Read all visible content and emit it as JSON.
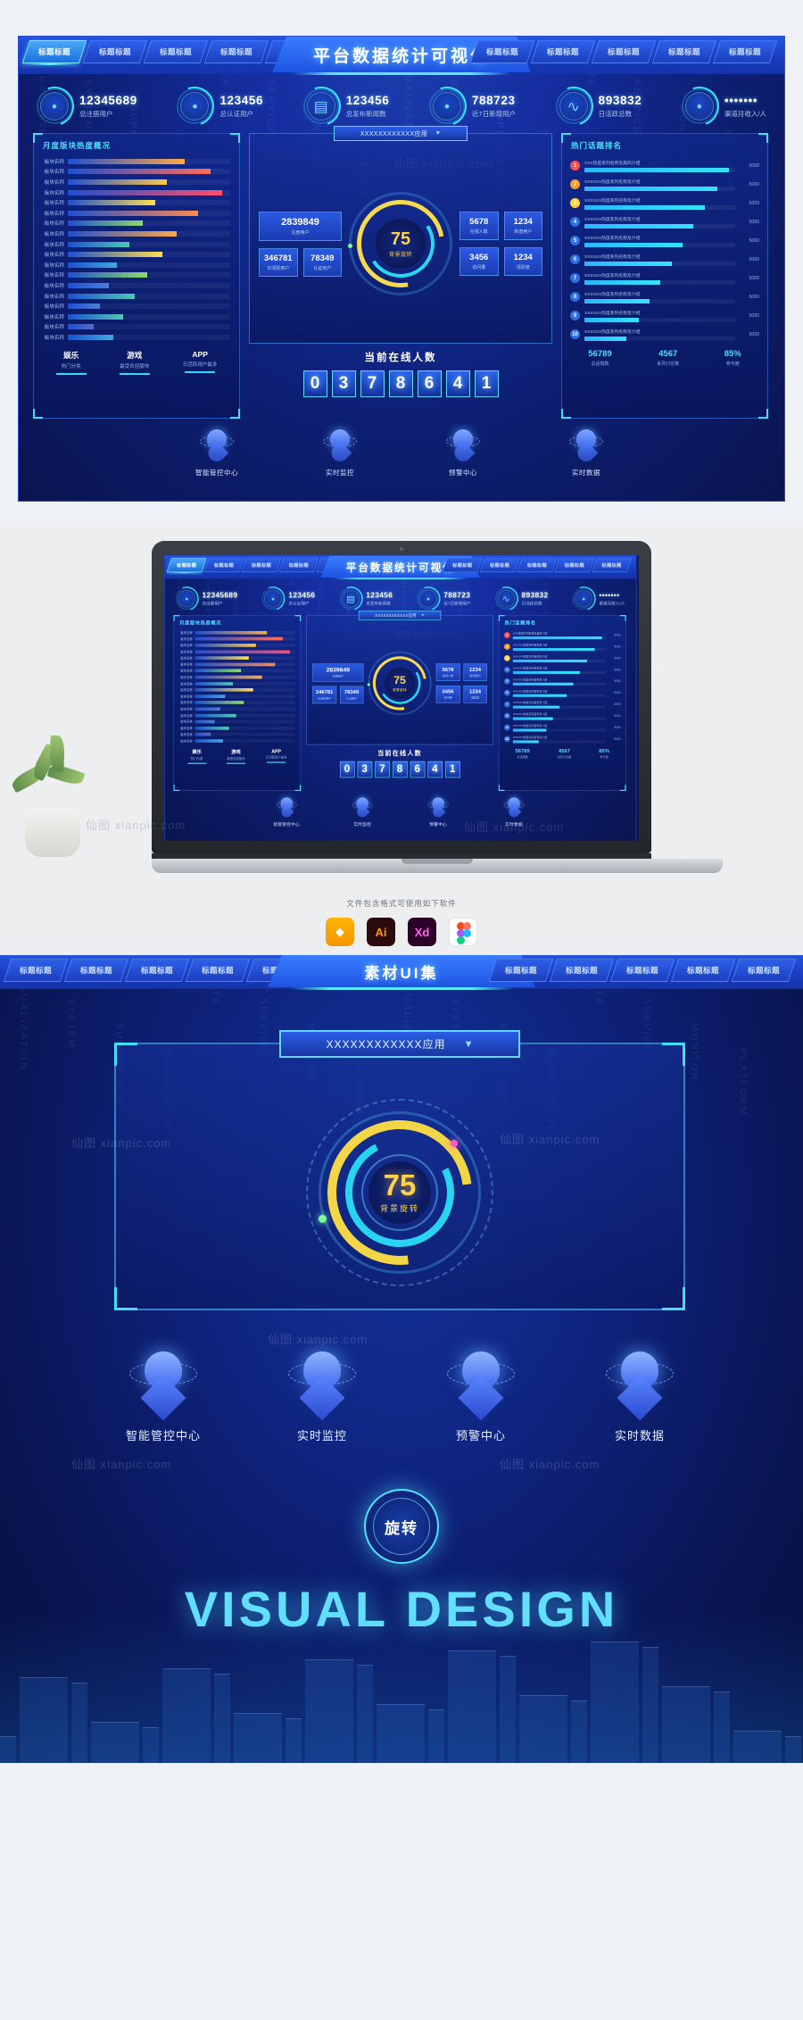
{
  "dashboard": {
    "title": "平台数据统计可视化",
    "tabs_left": [
      {
        "label": "标题标题",
        "active": true
      },
      {
        "label": "标题标题",
        "active": false
      },
      {
        "label": "标题标题",
        "active": false
      },
      {
        "label": "标题标题",
        "active": false
      },
      {
        "label": "标题标题",
        "active": false
      }
    ],
    "tabs_right": [
      {
        "label": "标题标题"
      },
      {
        "label": "标题标题"
      },
      {
        "label": "标题标题"
      },
      {
        "label": "标题标题"
      },
      {
        "label": "标题标题"
      }
    ],
    "stats": [
      {
        "icon": "user-icon",
        "glyph": "•",
        "value": "12345689",
        "label": "总注册用户"
      },
      {
        "icon": "user-verified-icon",
        "glyph": "•",
        "value": "123456",
        "label": "总认证用户"
      },
      {
        "icon": "news-icon",
        "glyph": "▤",
        "value": "123456",
        "label": "总发布新闻数"
      },
      {
        "icon": "user-add-icon",
        "glyph": "•",
        "value": "788723",
        "label": "近7日新增用户"
      },
      {
        "icon": "pulse-icon",
        "glyph": "∿",
        "value": "893832",
        "label": "日活跃总数"
      },
      {
        "icon": "person-in-icon",
        "glyph": "•",
        "value": "•••••••",
        "label": "渠道月收入/人"
      }
    ],
    "left_panel": {
      "title": "月度版块热度概况",
      "bars": [
        {
          "label": "板块名称",
          "value": 72
        },
        {
          "label": "板块名称",
          "value": 88
        },
        {
          "label": "板块名称",
          "value": 61
        },
        {
          "label": "板块名称",
          "value": 95
        },
        {
          "label": "板块名称",
          "value": 54
        },
        {
          "label": "板块名称",
          "value": 80
        },
        {
          "label": "板块名称",
          "value": 46
        },
        {
          "label": "板块名称",
          "value": 67
        },
        {
          "label": "板块名称",
          "value": 38
        },
        {
          "label": "板块名称",
          "value": 58
        },
        {
          "label": "板块名称",
          "value": 30
        },
        {
          "label": "板块名称",
          "value": 49
        },
        {
          "label": "板块名称",
          "value": 25
        },
        {
          "label": "板块名称",
          "value": 41
        },
        {
          "label": "板块名称",
          "value": 20
        },
        {
          "label": "板块名称",
          "value": 34
        },
        {
          "label": "板块名称",
          "value": 16
        },
        {
          "label": "板块名称",
          "value": 28
        }
      ],
      "legend": [
        {
          "title": "娱乐",
          "sub": "热门分类"
        },
        {
          "title": "游戏",
          "sub": "最受欢迎版块"
        },
        {
          "title": "APP",
          "sub": "日活跃用户最多"
        }
      ]
    },
    "middle_panel": {
      "selector_value": "XXXXXXXXXXXX应用",
      "selector_caret": "▼",
      "cells": [
        {
          "value": "2839849",
          "label": "注册用户"
        },
        {
          "value": "5678",
          "label": "在线人数"
        },
        {
          "value": "1234",
          "label": "新增用户"
        },
        {
          "value": "346781",
          "label": "日活跃用户"
        },
        {
          "value": "78349",
          "label": "认证用户"
        },
        {
          "value": "3456",
          "label": "访问量"
        },
        {
          "value": "1234",
          "label": "活跃度"
        }
      ],
      "gauge": {
        "value": "75",
        "caption": "背景旋转"
      },
      "online_title": "当前在线人数",
      "digits": [
        "0",
        "3",
        "7",
        "8",
        "6",
        "4",
        "1"
      ]
    },
    "right_panel": {
      "title": "热门话题排名",
      "rows": [
        {
          "rank": "1",
          "text": "XXX热度系列名称及其的介绍",
          "value": 96,
          "count": "5000"
        },
        {
          "rank": "2",
          "text": "XXXXXX热度系列名称及介绍",
          "value": 88,
          "count": "5000"
        },
        {
          "rank": "3",
          "text": "XXXXXX热度系列名称及介绍",
          "value": 80,
          "count": "5000"
        },
        {
          "rank": "4",
          "text": "XXXXXX热度系列名称及介绍",
          "value": 72,
          "count": "5000"
        },
        {
          "rank": "5",
          "text": "XXXXXX热度系列名称及介绍",
          "value": 65,
          "count": "5000"
        },
        {
          "rank": "6",
          "text": "XXXXXX热度系列名称及介绍",
          "value": 58,
          "count": "5000"
        },
        {
          "rank": "7",
          "text": "XXXXXX热度系列名称及介绍",
          "value": 50,
          "count": "5000"
        },
        {
          "rank": "8",
          "text": "XXXXXX热度系列名称及介绍",
          "value": 43,
          "count": "5000"
        },
        {
          "rank": "9",
          "text": "XXXXXX热度系列名称及介绍",
          "value": 36,
          "count": "5000"
        },
        {
          "rank": "10",
          "text": "XXXXXX热度系列名称及介绍",
          "value": 28,
          "count": "5000"
        }
      ],
      "footer": [
        {
          "value": "56789",
          "label": "总话题数"
        },
        {
          "value": "4567",
          "label": "系列讨论数"
        },
        {
          "value": "85%",
          "label": "参与度"
        }
      ]
    },
    "bottom_icons": [
      {
        "icon": "brain-control-icon",
        "label": "智能管控中心"
      },
      {
        "icon": "monitor-icon",
        "label": "实时监控"
      },
      {
        "icon": "alert-icon",
        "label": "预警中心"
      },
      {
        "icon": "funnel-data-icon",
        "label": "实时数据"
      }
    ]
  },
  "mockup": {
    "software_note": "文件包含格式可使用如下软件",
    "software": [
      {
        "name": "sketch-icon",
        "label": "◆"
      },
      {
        "name": "illustrator-icon",
        "label": "Ai"
      },
      {
        "name": "adobe-xd-icon",
        "label": "Xd"
      },
      {
        "name": "figma-icon",
        "label": ""
      }
    ]
  },
  "uikit": {
    "title": "素材UI集",
    "tabs_left": [
      {
        "label": "标题标题"
      },
      {
        "label": "标题标题"
      },
      {
        "label": "标题标题"
      },
      {
        "label": "标题标题"
      },
      {
        "label": "标题标题"
      }
    ],
    "tabs_right": [
      {
        "label": "标题标题"
      },
      {
        "label": "标题标题"
      },
      {
        "label": "标题标题"
      },
      {
        "label": "标题标题"
      },
      {
        "label": "标题标题"
      }
    ],
    "selector_value": "XXXXXXXXXXXX应用",
    "selector_caret": "▼",
    "gauge": {
      "value": "75",
      "caption": "背景旋转"
    },
    "icons": [
      {
        "icon": "brain-control-icon",
        "label": "智能管控中心"
      },
      {
        "icon": "monitor-icon",
        "label": "实时监控"
      },
      {
        "icon": "alert-icon",
        "label": "预警中心"
      },
      {
        "icon": "funnel-data-icon",
        "label": "实时数据"
      }
    ],
    "rotate_badge": "旋转",
    "visual_title": "VISUAL DESIGN"
  },
  "watermarks": [
    "仙图 xianpic.com",
    "仙图 xianpic.com",
    "仙图 xianpic.com"
  ],
  "colors": {
    "accent_cyan": "#3fe0ff",
    "accent_blue": "#2a5de8",
    "gauge_yellow": "#ffd24a",
    "bar_warm": "#ff4d6a",
    "bg_deep": "#0a1450"
  }
}
